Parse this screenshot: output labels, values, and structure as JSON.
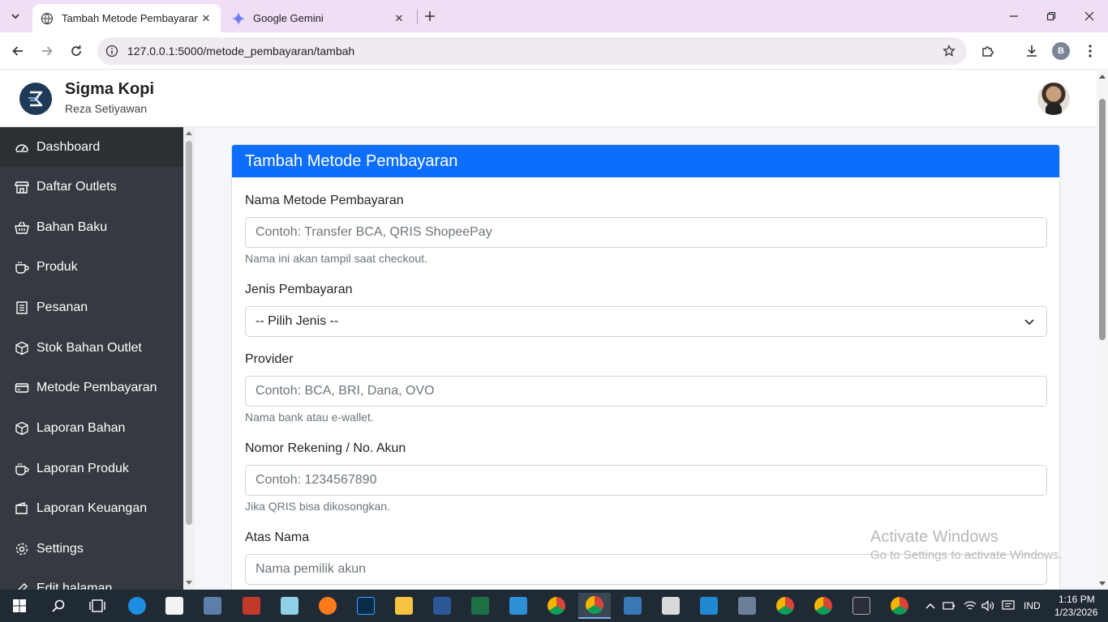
{
  "browser": {
    "tabs": [
      {
        "title": "Tambah Metode Pembayaran | S",
        "active": true
      },
      {
        "title": "Google Gemini",
        "active": false
      }
    ],
    "url": "127.0.0.1:5000/metode_pembayaran/tambah",
    "profile_initial": "B"
  },
  "app": {
    "brand": "Sigma Kopi",
    "user_name": "Reza Setiyawan"
  },
  "sidebar": {
    "items": [
      {
        "label": "Dashboard",
        "icon": "dashboard-icon",
        "active": true
      },
      {
        "label": "Daftar Outlets",
        "icon": "store-icon"
      },
      {
        "label": "Bahan Baku",
        "icon": "basket-icon"
      },
      {
        "label": "Produk",
        "icon": "cup-icon"
      },
      {
        "label": "Pesanan",
        "icon": "list-icon"
      },
      {
        "label": "Stok Bahan Outlet",
        "icon": "box-icon"
      },
      {
        "label": "Metode Pembayaran",
        "icon": "credit-card-icon"
      },
      {
        "label": "Laporan Bahan",
        "icon": "box-icon"
      },
      {
        "label": "Laporan Produk",
        "icon": "cup-icon"
      },
      {
        "label": "Laporan Keuangan",
        "icon": "wallet-icon"
      },
      {
        "label": "Settings",
        "icon": "gear-icon"
      },
      {
        "label": "Edit halaman",
        "icon": "edit-icon"
      }
    ]
  },
  "form": {
    "title": "Tambah Metode Pembayaran",
    "fields": {
      "nama": {
        "label": "Nama Metode Pembayaran",
        "placeholder": "Contoh: Transfer BCA, QRIS ShopeePay",
        "help": "Nama ini akan tampil saat checkout."
      },
      "jenis": {
        "label": "Jenis Pembayaran",
        "selected": "-- Pilih Jenis --"
      },
      "provider": {
        "label": "Provider",
        "placeholder": "Contoh: BCA, BRI, Dana, OVO",
        "help": "Nama bank atau e-wallet."
      },
      "nomor": {
        "label": "Nomor Rekening / No. Akun",
        "placeholder": "Contoh: 1234567890",
        "help": "Jika QRIS bisa dikosongkan."
      },
      "atas_nama": {
        "label": "Atas Nama",
        "placeholder": "Nama pemilik akun"
      }
    }
  },
  "watermark": {
    "line1": "Activate Windows",
    "line2": "Go to Settings to activate Windows."
  },
  "taskbar": {
    "language": "IND",
    "time": "1:16 PM",
    "date": "1/23/2026"
  },
  "colors": {
    "primary": "#0d6efd",
    "sidebar": "#343a40",
    "tabbar": "#f0def5"
  }
}
